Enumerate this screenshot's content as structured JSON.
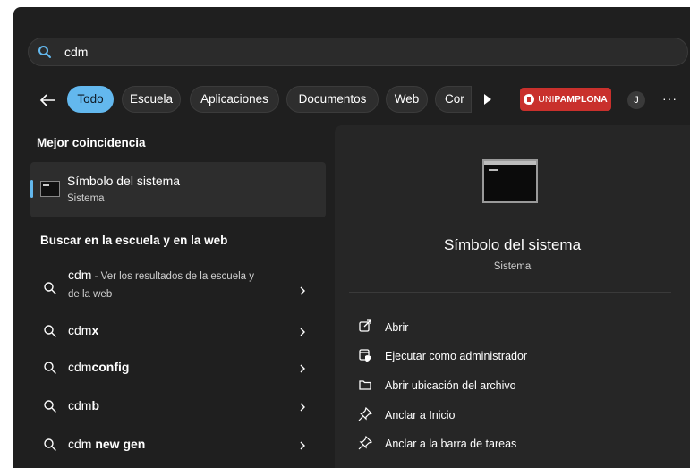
{
  "search": {
    "query": "cdm"
  },
  "filters": [
    "Todo",
    "Escuela",
    "Aplicaciones",
    "Documentos",
    "Web",
    "Cor"
  ],
  "brand": {
    "prefix": "UNI",
    "name": "PAMPLONA"
  },
  "avatar_initial": "J",
  "more_label": "···",
  "best_match": {
    "section_title": "Mejor coincidencia",
    "title": "Símbolo del sistema",
    "subtitle": "Sistema"
  },
  "web_section": {
    "title": "Buscar en la escuela y en la web",
    "first": {
      "query": "cdm",
      "line1": " - Ver los resultados de la escuela y",
      "line2": "de la web"
    },
    "items": [
      {
        "prefix": "cdm",
        "bold": "x"
      },
      {
        "prefix": "cdm",
        "bold": "config"
      },
      {
        "prefix": "cdm",
        "bold": "b"
      },
      {
        "prefix": "cdm ",
        "bold": "new gen"
      }
    ]
  },
  "detail": {
    "title": "Símbolo del sistema",
    "subtitle": "Sistema",
    "actions": [
      {
        "label": "Abrir",
        "icon": "open-icon"
      },
      {
        "label": "Ejecutar como administrador",
        "icon": "shield-icon"
      },
      {
        "label": "Abrir ubicación del archivo",
        "icon": "folder-icon"
      },
      {
        "label": "Anclar a Inicio",
        "icon": "pin-icon"
      },
      {
        "label": "Anclar a la barra de tareas",
        "icon": "pin-icon"
      }
    ]
  },
  "colors": {
    "accent": "#63b8ee",
    "panel": "#1f1f1f",
    "brand": "#c9302c"
  }
}
